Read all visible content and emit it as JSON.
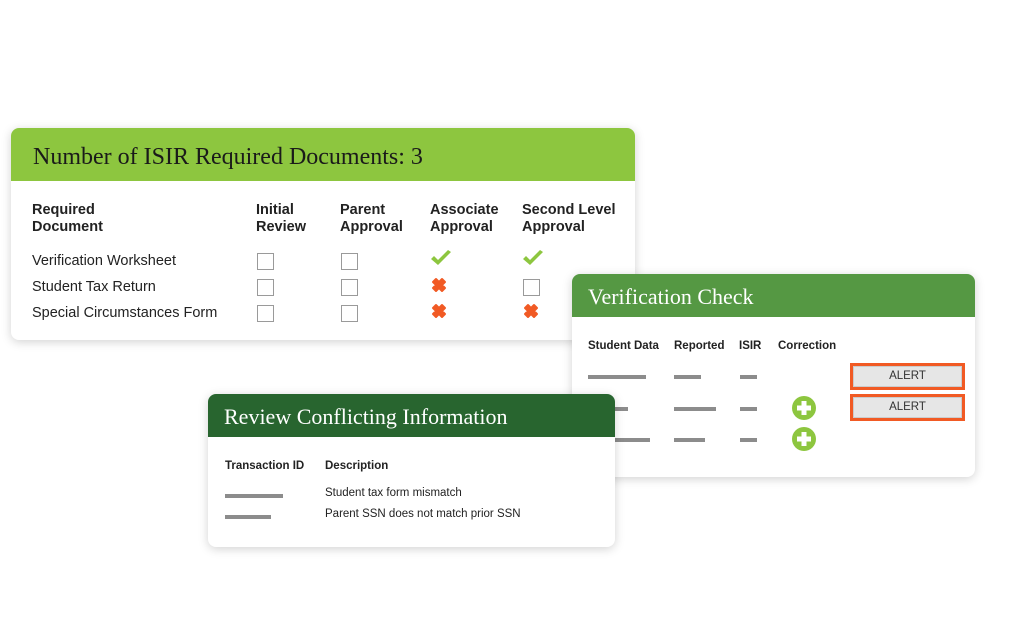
{
  "required_docs_card": {
    "title": "Number of ISIR Required Documents: 3",
    "header_color": "#8dc63f",
    "columns": [
      {
        "line1": "Required",
        "line2": "Document"
      },
      {
        "line1": "Initial",
        "line2": "Review"
      },
      {
        "line1": "Parent",
        "line2": "Approval"
      },
      {
        "line1": "Associate",
        "line2": "Approval"
      },
      {
        "line1": "Second Level",
        "line2": "Approval"
      }
    ],
    "rows": [
      {
        "document": "Verification Worksheet",
        "statuses": [
          "unchecked",
          "unchecked",
          "approved",
          "approved"
        ]
      },
      {
        "document": "Student Tax Return",
        "statuses": [
          "unchecked",
          "unchecked",
          "rejected",
          "unchecked"
        ]
      },
      {
        "document": "Special Circumstances Form",
        "statuses": [
          "unchecked",
          "unchecked",
          "rejected",
          "rejected"
        ]
      }
    ],
    "status_colors": {
      "approved": "#8dc63f",
      "rejected": "#f15a24"
    }
  },
  "verification_card": {
    "title": "Verification Check",
    "header_color": "#559843",
    "columns": [
      "Student Data",
      "Reported",
      "ISIR",
      "Correction"
    ],
    "rows": [
      {
        "correction": false,
        "alert": true
      },
      {
        "correction": true,
        "alert": true
      },
      {
        "correction": true,
        "alert": false
      }
    ],
    "alert_label": "ALERT",
    "alert_color": "#f15a24",
    "correction_icon": "plus-circle-icon"
  },
  "conflict_card": {
    "title": "Review Conflicting Information",
    "header_color": "#28652f",
    "columns": [
      "Transaction ID",
      "Description"
    ],
    "rows": [
      {
        "description": "Student tax form mismatch"
      },
      {
        "description": "Parent SSN does not match prior SSN"
      }
    ]
  }
}
